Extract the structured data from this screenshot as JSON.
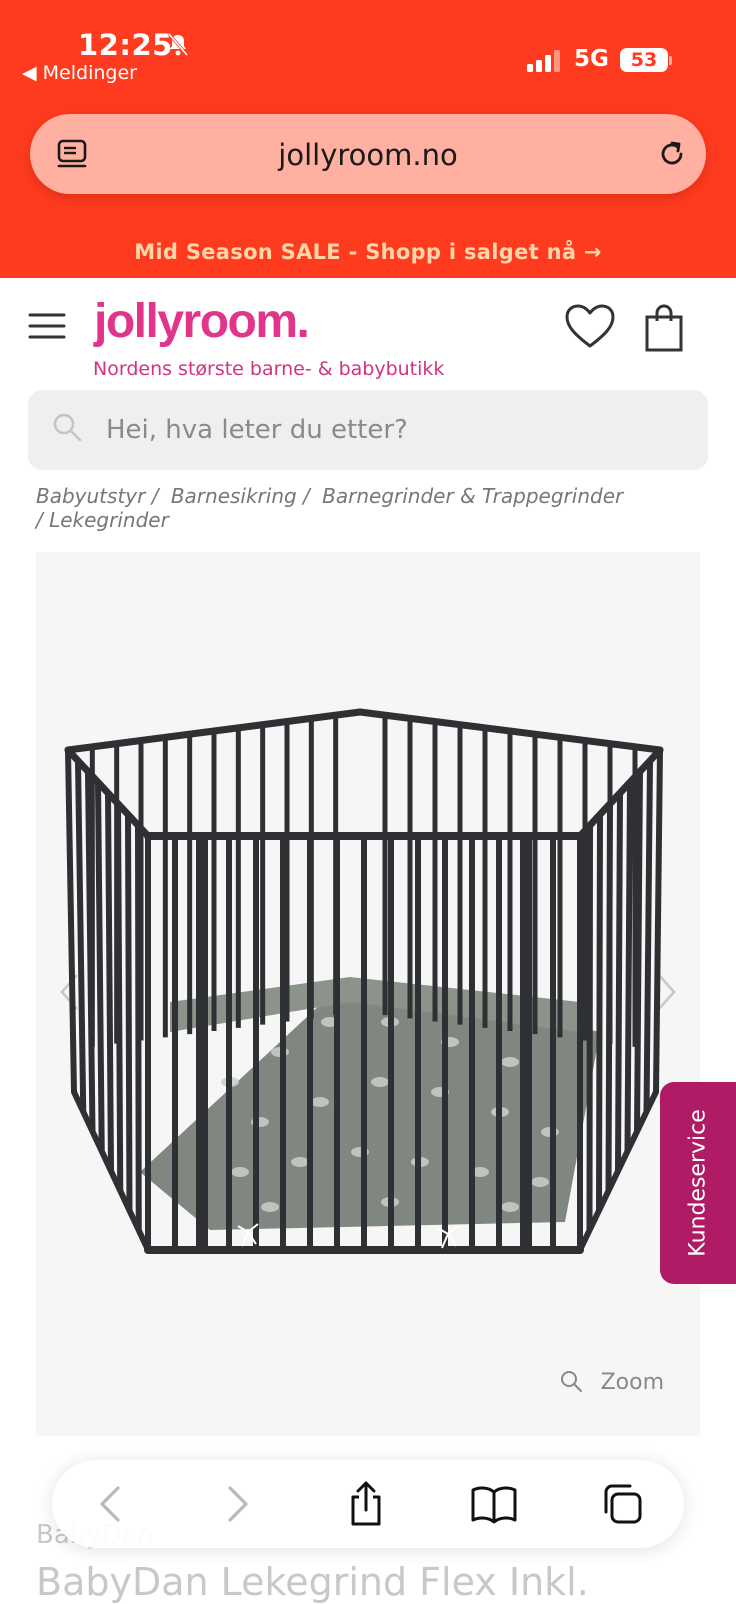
{
  "status": {
    "time": "12:25",
    "back_app": "◀ Meldinger",
    "network": "5G",
    "battery": "53"
  },
  "browser": {
    "url": "jollyroom.no"
  },
  "promo": {
    "text": "Mid Season SALE - Shopp i salget nå →"
  },
  "header": {
    "logo": "jollyroom.",
    "tagline": "Nordens største barne- & babybutikk"
  },
  "search": {
    "placeholder": "Hei, hva leter du etter?"
  },
  "breadcrumb": [
    "Babyutstyr /",
    "Barnesikring /",
    "Barnegrinder & Trappegrinder",
    "/  Lekegrinder"
  ],
  "gallery": {
    "zoom_label": "Zoom"
  },
  "support": {
    "label": "Kundeservice"
  },
  "product": {
    "brand": "BabyDan",
    "title": "BabyDan Lekegrind Flex Inkl."
  },
  "colors": {
    "topbar": "#ff3b1f",
    "brand_pink": "#e0358a",
    "support_tab": "#b01b66"
  },
  "icons": [
    "bell-muted-icon",
    "signal-icon",
    "reader-icon",
    "reload-icon",
    "menu-icon",
    "heart-icon",
    "bag-icon",
    "search-icon",
    "chevron-left-icon",
    "chevron-right-icon",
    "zoom-icon",
    "back-icon",
    "forward-icon",
    "share-icon",
    "bookmarks-icon",
    "tabs-icon"
  ]
}
